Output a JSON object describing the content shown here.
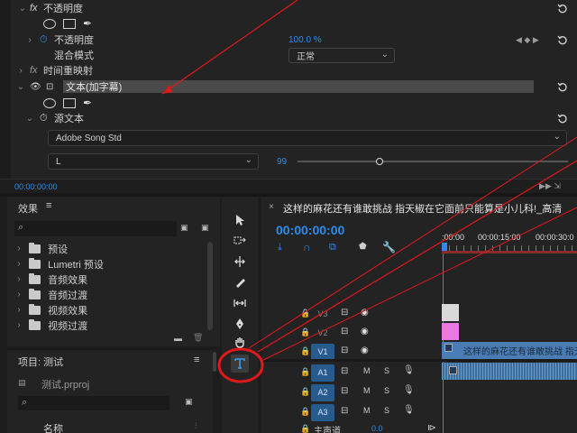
{
  "effect_controls": {
    "opacity_section": {
      "label": "不透明度"
    },
    "opacity_param": {
      "label": "不透明度",
      "value": "100.0 %"
    },
    "blend_mode": {
      "label": "混合模式",
      "value": "正常"
    },
    "time_remap": {
      "label": "时间重映射"
    },
    "text_effect": {
      "label": "文本(加字幕)"
    },
    "source_text": {
      "label": "源文本"
    },
    "font": {
      "value": "Adobe Song Std"
    },
    "font_style": {
      "value": "L"
    },
    "font_size": {
      "value": "99",
      "slider_level": 0.29
    },
    "timecode": "00:00:00:00"
  },
  "effects_panel": {
    "title": "效果",
    "items": [
      {
        "label": "预设"
      },
      {
        "label": "Lumetri 预设"
      },
      {
        "label": "音频效果"
      },
      {
        "label": "音频过渡"
      },
      {
        "label": "视频效果"
      },
      {
        "label": "视频过渡"
      }
    ]
  },
  "project_panel": {
    "title": "项目: 测试",
    "file": "测试.prproj",
    "column_name": "名称"
  },
  "timeline": {
    "title": "这样的麻花还有谁敢挑战 指天椒在它面前只能算是小儿科!_高清",
    "timecode": "00:00:00:00",
    "ruler": [
      ":00:00",
      "00:00:15:00",
      "00:00:30:0"
    ],
    "tracks": [
      {
        "label": "V3",
        "targeted": false
      },
      {
        "label": "V2",
        "targeted": false
      },
      {
        "label": "V1",
        "targeted": true
      },
      {
        "label": "A1",
        "targeted": true
      },
      {
        "label": "A2",
        "targeted": true
      },
      {
        "label": "A3",
        "targeted": true
      }
    ],
    "clip_label": "这样的麻花还有谁敢挑战 指天",
    "mix_label": "主声道",
    "mix_value": "0.0",
    "track_btn_m": "M",
    "track_btn_s": "S"
  },
  "colors": {
    "accent_blue": "#2d8ceb",
    "annotation_red": "#e0181b",
    "v2_clip": "#e879e1",
    "v3_clip": "#d9d9d9",
    "v1_clip": "#4a7db5",
    "audio_clip": "#3c6f9d",
    "playhead": "#2d8ceb",
    "work_area": "#e8d04a"
  },
  "tools": [
    "selection-tool-icon",
    "track-select-tool-icon",
    "ripple-edit-tool-icon",
    "razor-tool-icon",
    "slip-tool-icon",
    "pen-tool-icon",
    "hand-tool-icon",
    "type-tool-icon"
  ]
}
